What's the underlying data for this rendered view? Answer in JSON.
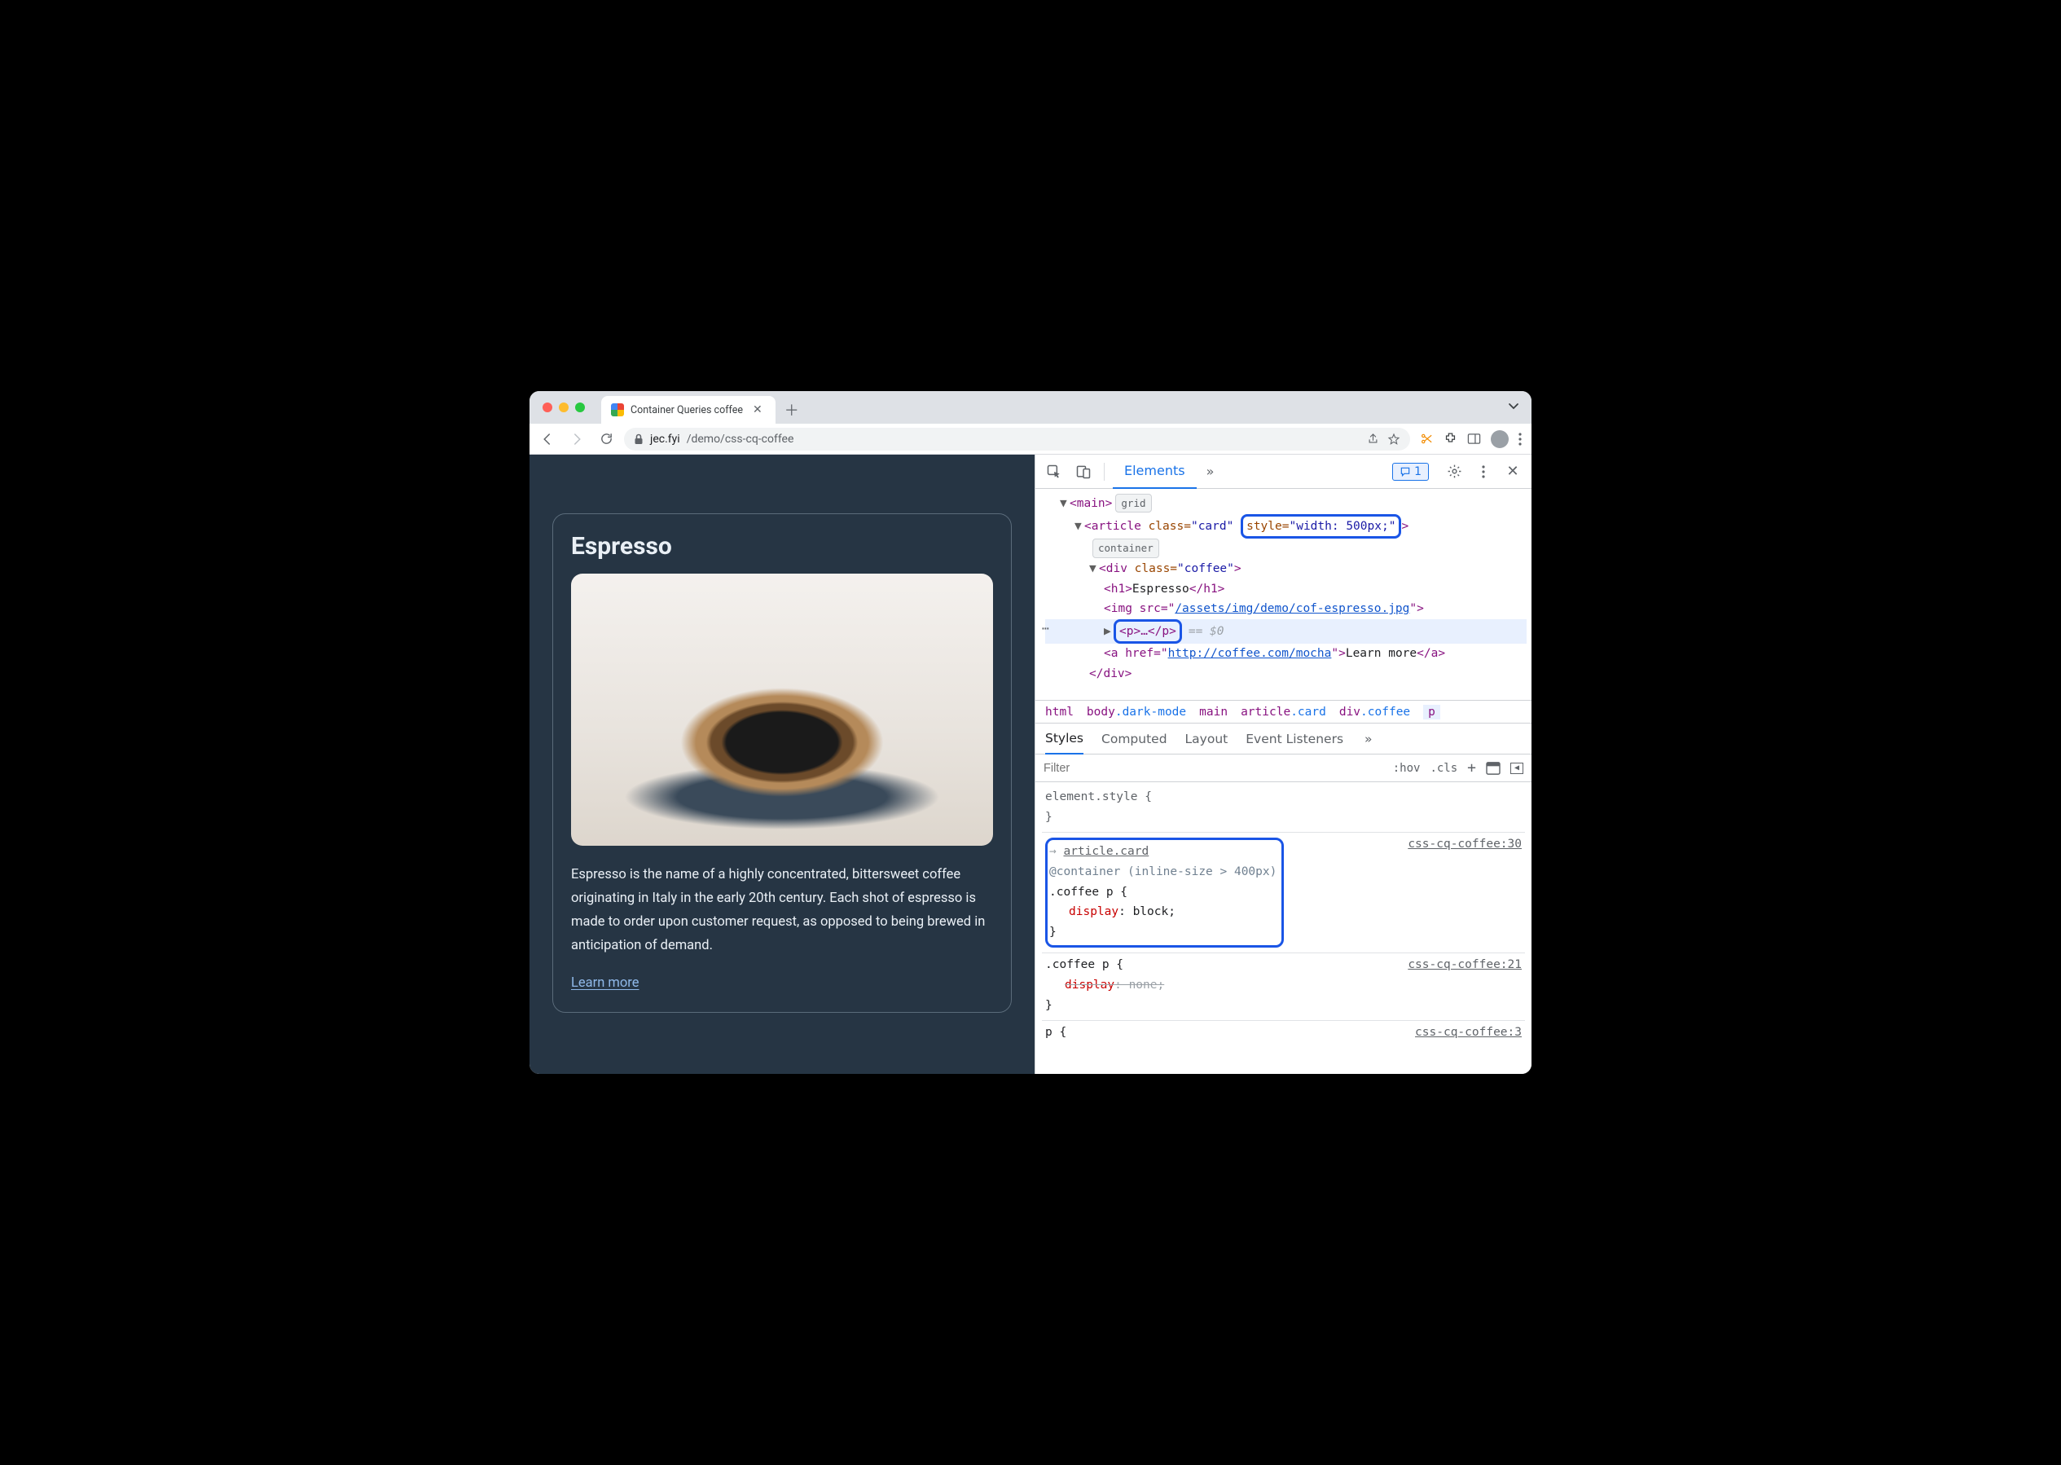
{
  "browser": {
    "tab_title": "Container Queries coffee",
    "url_host": "jec.fyi",
    "url_path": "/demo/css-cq-coffee"
  },
  "page": {
    "title": "Espresso",
    "body": "Espresso is the name of a highly concentrated, bittersweet coffee originating in Italy in the early 20th century. Each shot of espresso is made to order upon customer request, as opposed to being brewed in anticipation of demand.",
    "link_label": "Learn more"
  },
  "devtools": {
    "top": {
      "tab_elements": "Elements",
      "issue_count": "1"
    },
    "elements": {
      "main_open": "<main>",
      "main_badge": "grid",
      "article_open_pre": "<article ",
      "article_class_attr": "class=",
      "article_class_val": "\"card\"",
      "article_style_attr": "style=",
      "article_style_val": "\"width: 500px;\"",
      "article_close": ">",
      "article_badge": "container",
      "div_open": "<div class=\"coffee\">",
      "h1_line": "<h1>Espresso</h1>",
      "img_pre": "<img src=\"",
      "img_src": "/assets/img/demo/cof-espresso.jpg",
      "img_post": "\">",
      "p_line": "<p>…</p>",
      "eq0": "== $0",
      "a_pre": "<a href=\"",
      "a_href": "http://coffee.com/mocha",
      "a_mid": "\">Learn more</a>",
      "div_close": "</div>"
    },
    "breadcrumb": {
      "i0": "html",
      "i1a": "body",
      "i1b": ".dark-mode",
      "i2": "main",
      "i3a": "article",
      "i3b": ".card",
      "i4a": "div",
      "i4b": ".coffee",
      "i5": "p"
    },
    "styles_tabs": {
      "t0": "Styles",
      "t1": "Computed",
      "t2": "Layout",
      "t3": "Event Listeners"
    },
    "filter": {
      "placeholder": "Filter",
      "hov": ":hov",
      "cls": ".cls",
      "plus": "+"
    },
    "rules": {
      "r0_sel": "element.style {",
      "r0_close": "}",
      "r1_link": "article.card",
      "r1_at": "@container (inline-size > 400px)",
      "r1_sel": ".coffee p {",
      "r1_prop": "display",
      "r1_val": ": block;",
      "r1_close": "}",
      "r1_src": "css-cq-coffee:30",
      "r2_sel": ".coffee p {",
      "r2_prop": "display",
      "r2_val": ": none;",
      "r2_close": "}",
      "r2_src": "css-cq-coffee:21",
      "r3_sel": "p {",
      "r3_src": "css-cq-coffee:3"
    }
  }
}
